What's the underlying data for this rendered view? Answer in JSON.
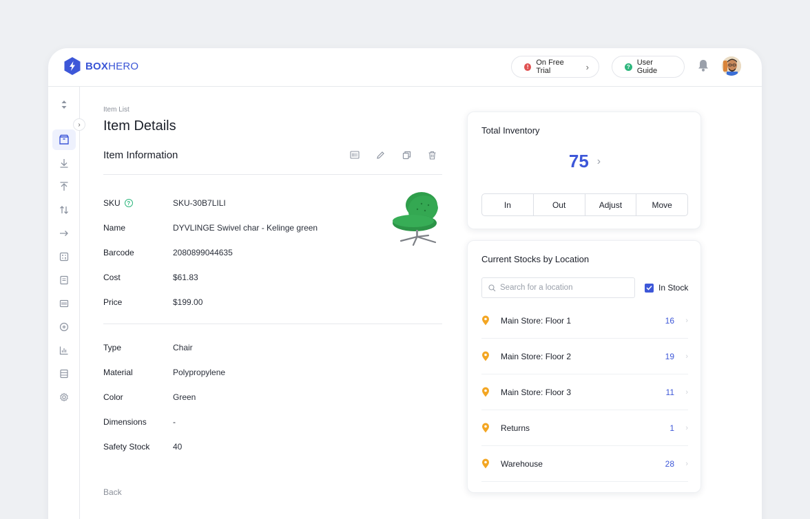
{
  "header": {
    "logo_bold": "BOX",
    "logo_light": "HERO",
    "trial_label": "On Free Trial",
    "guide_label": "User Guide"
  },
  "sidebar": {
    "icons": [
      "sort-icon",
      "box-icon",
      "download-icon",
      "upload-icon",
      "transfer-icon",
      "move-icon",
      "calculator-icon",
      "document-icon",
      "barcode-icon",
      "plus-circle-icon",
      "bar-chart-icon",
      "list-icon",
      "settings-icon"
    ]
  },
  "main": {
    "breadcrumb": "Item List",
    "title": "Item Details",
    "section_title": "Item Information",
    "tools": [
      "barcode-print-icon",
      "edit-icon",
      "copy-icon",
      "trash-icon"
    ],
    "fields": [
      {
        "label": "SKU",
        "value": "SKU-30B7LILI"
      },
      {
        "label": "Name",
        "value": "DYVLINGE Swivel char - Kelinge green"
      },
      {
        "label": "Barcode",
        "value": "2080899044635"
      },
      {
        "label": "Cost",
        "value": "$61.83"
      },
      {
        "label": "Price",
        "value": "$199.00"
      }
    ],
    "attributes": [
      {
        "label": "Type",
        "value": "Chair"
      },
      {
        "label": "Material",
        "value": "Polypropylene"
      },
      {
        "label": "Color",
        "value": "Green"
      },
      {
        "label": "Dimensions",
        "value": "-"
      },
      {
        "label": "Safety Stock",
        "value": "40"
      }
    ],
    "back_label": "Back"
  },
  "inventory": {
    "title": "Total Inventory",
    "total": "75",
    "actions": [
      "In",
      "Out",
      "Adjust",
      "Move"
    ]
  },
  "locations": {
    "title": "Current Stocks by Location",
    "search_placeholder": "Search for a location",
    "in_stock_label": "In Stock",
    "in_stock_checked": true,
    "items": [
      {
        "name": "Main Store: Floor 1",
        "qty": "16"
      },
      {
        "name": "Main Store: Floor 2",
        "qty": "19"
      },
      {
        "name": "Main Store: Floor 3",
        "qty": "11"
      },
      {
        "name": "Returns",
        "qty": "1"
      },
      {
        "name": "Warehouse",
        "qty": "28"
      }
    ]
  },
  "colors": {
    "accent": "#3d57d8",
    "trial_dot": "#e05252",
    "guide_dot": "#2eb67d",
    "pin": "#f3a623",
    "chair": "#2e9e4a"
  }
}
